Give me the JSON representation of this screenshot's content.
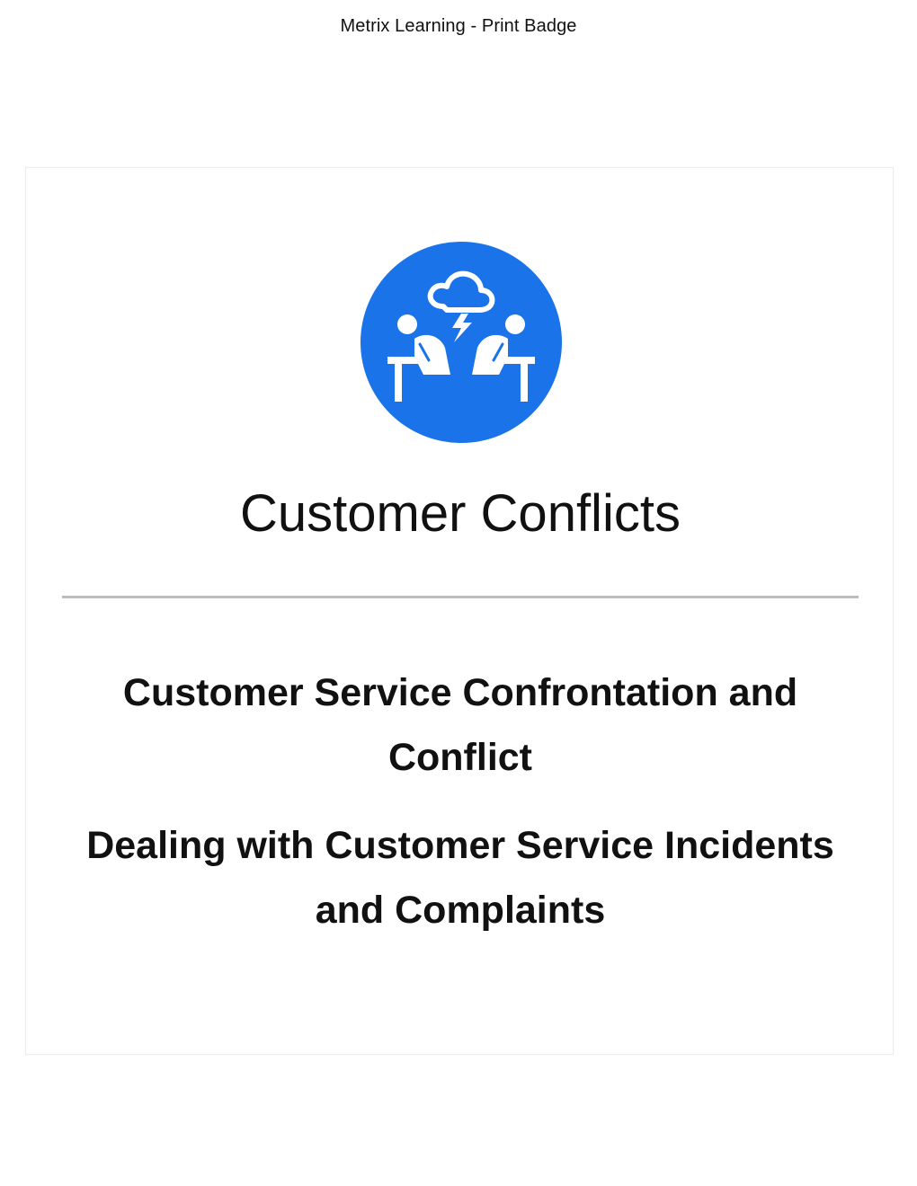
{
  "header": {
    "title": "Metrix Learning - Print Badge"
  },
  "badge": {
    "icon": "customer-conflict-icon",
    "icon_color": "#1a73e8",
    "name": "Customer Conflicts",
    "courses": [
      "Customer Service Confrontation and Conflict",
      "Dealing with Customer Service Incidents and Complaints"
    ]
  }
}
